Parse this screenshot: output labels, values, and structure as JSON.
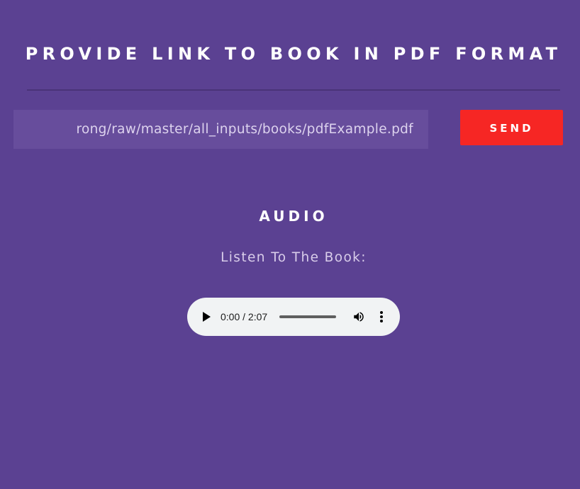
{
  "header": {
    "title": "PROVIDE LINK TO BOOK IN PDF FORMAT"
  },
  "form": {
    "url_value": "rong/raw/master/all_inputs/books/pdfExample.pdf",
    "send_label": "SEND"
  },
  "audio_section": {
    "title": "AUDIO",
    "label": "Listen To The Book:",
    "player": {
      "time": "0:00 / 2:07",
      "progress": 0
    }
  },
  "colors": {
    "background": "#5b4192",
    "input_background": "#674d9c",
    "send_button": "#f62624",
    "player_background": "#f1f3f4"
  },
  "icons": {
    "play": "play-icon",
    "volume": "volume-icon",
    "menu": "more-vertical-icon"
  }
}
